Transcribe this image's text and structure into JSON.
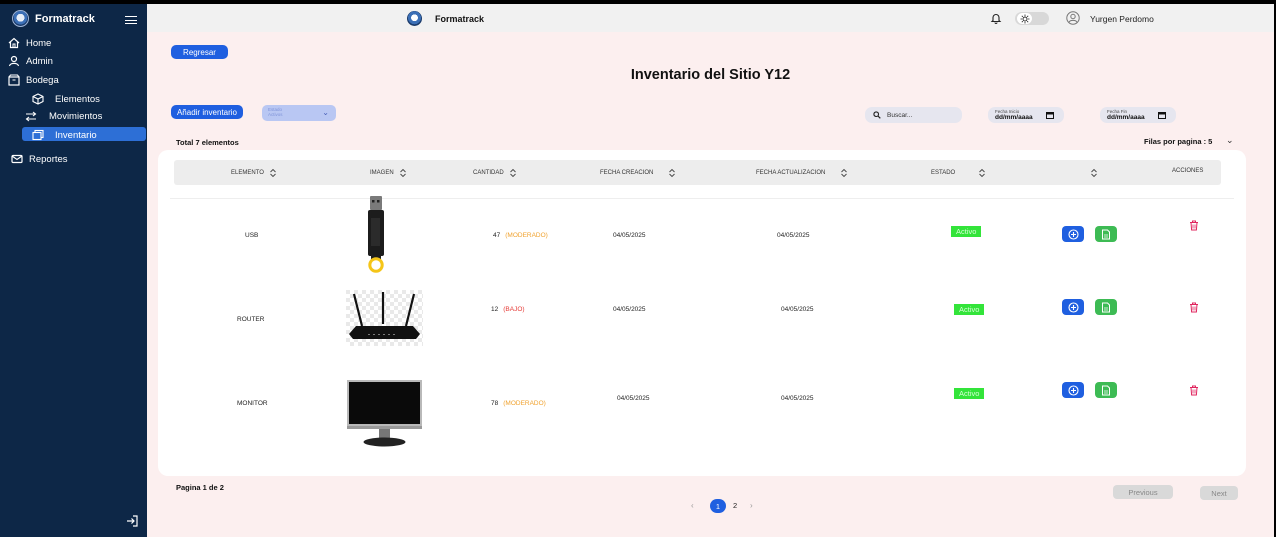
{
  "app": {
    "brand": "Formatrack"
  },
  "sidebar": {
    "items": [
      {
        "label": "Home",
        "icon": "home-icon"
      },
      {
        "label": "Admin",
        "icon": "user-icon"
      },
      {
        "label": "Bodega",
        "icon": "box-icon"
      },
      {
        "label": "Elementos",
        "icon": "cube-icon"
      },
      {
        "label": "Movimientos",
        "icon": "arrows-icon"
      },
      {
        "label": "Inventario",
        "icon": "inventory-icon",
        "active": true
      },
      {
        "label": "Reportes",
        "icon": "mail-icon"
      }
    ]
  },
  "topbar": {
    "title": "Formatrack",
    "user_name": "Yurgen Perdomo"
  },
  "main": {
    "back_button": "Regresar",
    "title": "Inventario del Sitio Y12",
    "add_button": "Añadir inventario",
    "estado_filter": {
      "label_line1": "Estado",
      "label_line2": "Activos"
    },
    "search_placeholder": "Buscar...",
    "fecha_inicio": {
      "caption": "Fecha Inicio",
      "value": "dd/mm/aaaa"
    },
    "fecha_fin": {
      "caption": "Fecha Fin",
      "value": "dd/mm/aaaa"
    },
    "total": "Total 7 elementos",
    "filas": "Filas por pagina : 5",
    "columns": [
      "ELEMENTO",
      "IMAGEN",
      "CANTIDAD",
      "FECHA CREACION",
      "FECHA ACTUALIZACION",
      "ESTADO",
      "",
      "ACCIONES"
    ],
    "rows": [
      {
        "elemento": "USB",
        "cantidad": "47",
        "nivel": "(MODERADO)",
        "nivel_color": "#f0a22e",
        "fecha_creacion": "04/05/2025",
        "fecha_actualizacion": "04/05/2025",
        "estado": "Activo"
      },
      {
        "elemento": "ROUTER",
        "cantidad": "12",
        "nivel": "(BAJO)",
        "nivel_color": "#e53935",
        "fecha_creacion": "04/05/2025",
        "fecha_actualizacion": "04/05/2025",
        "estado": "Activo"
      },
      {
        "elemento": "MONITOR",
        "cantidad": "78",
        "nivel": "(MODERADO)",
        "nivel_color": "#f0a22e",
        "fecha_creacion": "04/05/2025",
        "fecha_actualizacion": "04/05/2025",
        "estado": "Activo"
      }
    ],
    "pagina": "Pagina 1 de 2",
    "pages": [
      "1",
      "2"
    ],
    "current_page": "1",
    "previous": "Previous",
    "next": "Next"
  },
  "colors": {
    "sidebar": "#0d2747",
    "accent": "#1f5fe0",
    "success": "#33e43a",
    "background": "#fcefef"
  }
}
